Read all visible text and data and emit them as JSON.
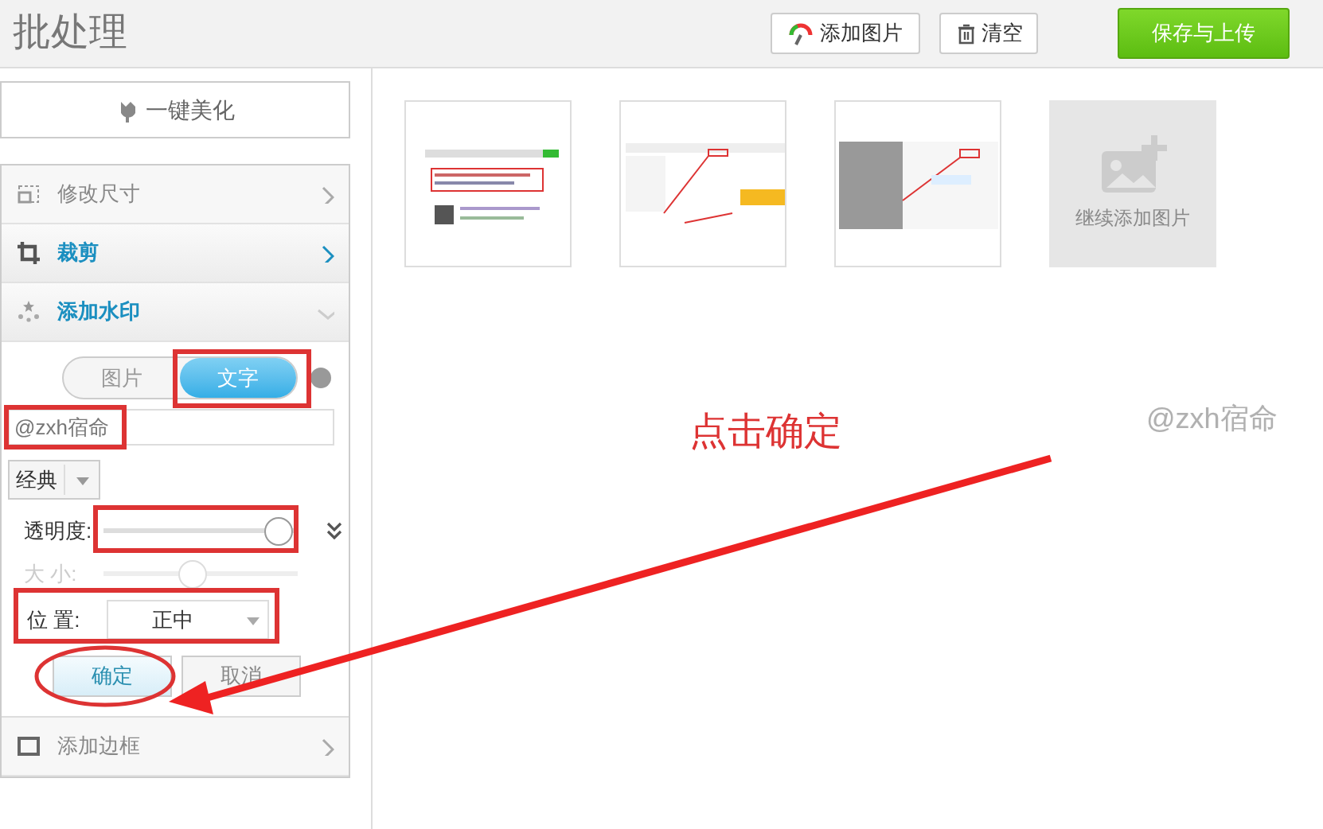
{
  "header": {
    "title": "批处理",
    "buttons": [
      {
        "kind": "add",
        "label": "添加图片"
      },
      {
        "kind": "clear",
        "label": "清空"
      }
    ],
    "save_button": "保存与上传"
  },
  "beautify_button": "一键美化",
  "sections": [
    {
      "kind": "resize",
      "label": "修改尺寸",
      "highlighted": false,
      "expanded": false
    },
    {
      "kind": "crop",
      "label": "裁剪",
      "highlighted": true,
      "expanded": false
    },
    {
      "kind": "watermark",
      "label": "添加水印",
      "highlighted": true,
      "expanded": true
    },
    {
      "kind": "border",
      "label": "添加边框",
      "highlighted": false,
      "expanded": false
    }
  ],
  "watermark": {
    "tabs": [
      {
        "label": "图片",
        "selected": false
      },
      {
        "label": "文字",
        "selected": true
      }
    ],
    "text_field": "@zxh宿命",
    "style_dropdown": "经典",
    "sliders": [
      {
        "label": "透明度:",
        "level": 0.97,
        "disabled": false
      },
      {
        "label": "大 小:",
        "level": 0.45,
        "disabled": true
      }
    ],
    "position": {
      "label": "位 置:",
      "value": "正中"
    },
    "confirm_button": "确定",
    "cancel_button": "取消"
  },
  "add_tile": "继续添加图片",
  "watermark_preview": "@zxh宿命",
  "annotation": "点击确定"
}
